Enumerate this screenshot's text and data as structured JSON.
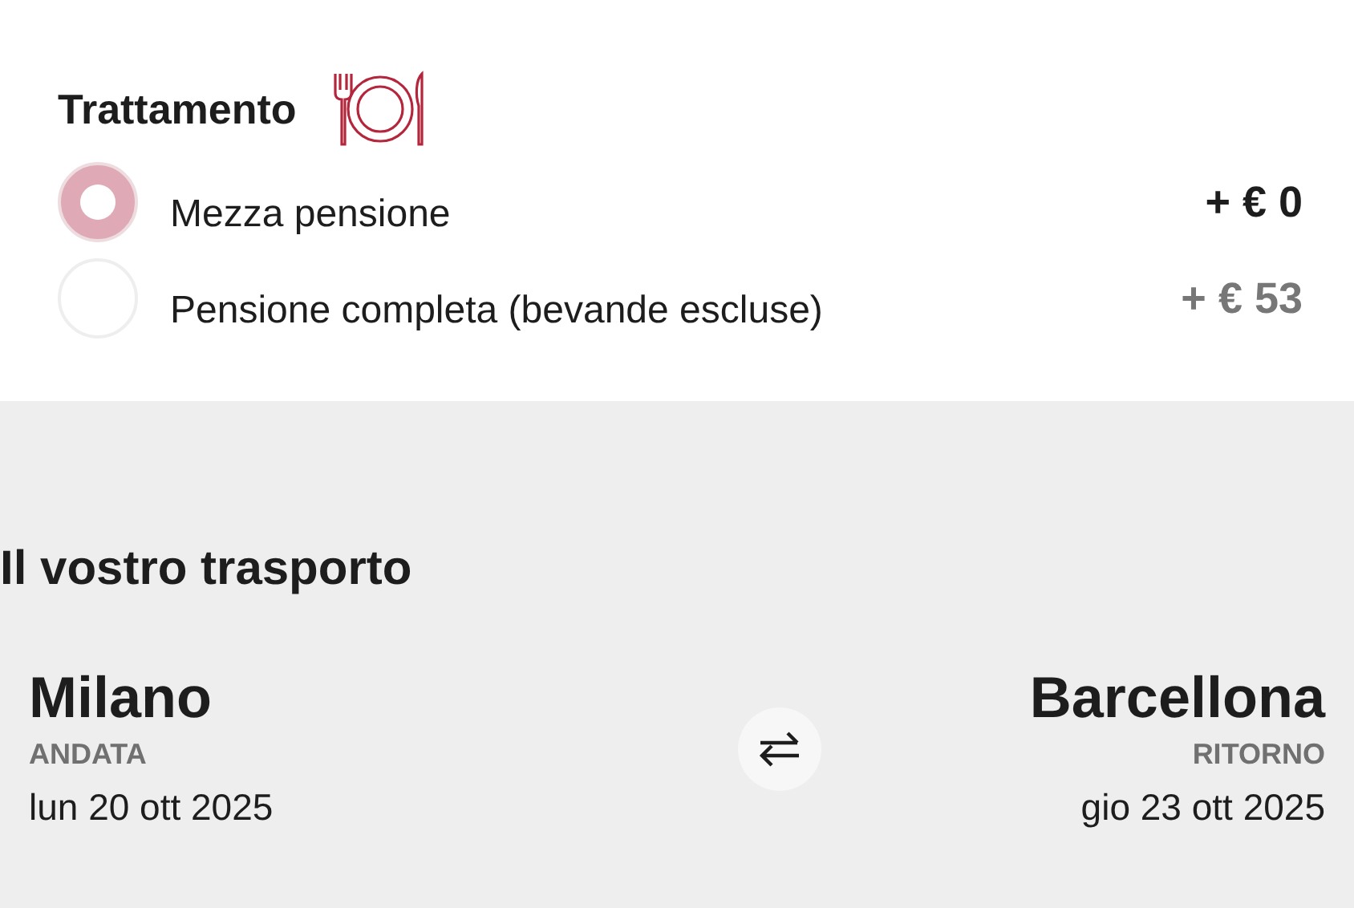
{
  "board": {
    "title": "Trattamento",
    "options": [
      {
        "label": "Mezza pensione",
        "price": "+ € 0",
        "selected": true
      },
      {
        "label": "Pensione completa (bevande escluse)",
        "price": "+ € 53",
        "selected": false
      }
    ]
  },
  "transport": {
    "title": "Il vostro trasporto",
    "legs": [
      {
        "city": "Milano",
        "kind": "ANDATA",
        "date": "lun 20 ott 2025"
      },
      {
        "city": "Barcellona",
        "kind": "RITORNO",
        "date": "gio 23 ott 2025"
      }
    ]
  }
}
